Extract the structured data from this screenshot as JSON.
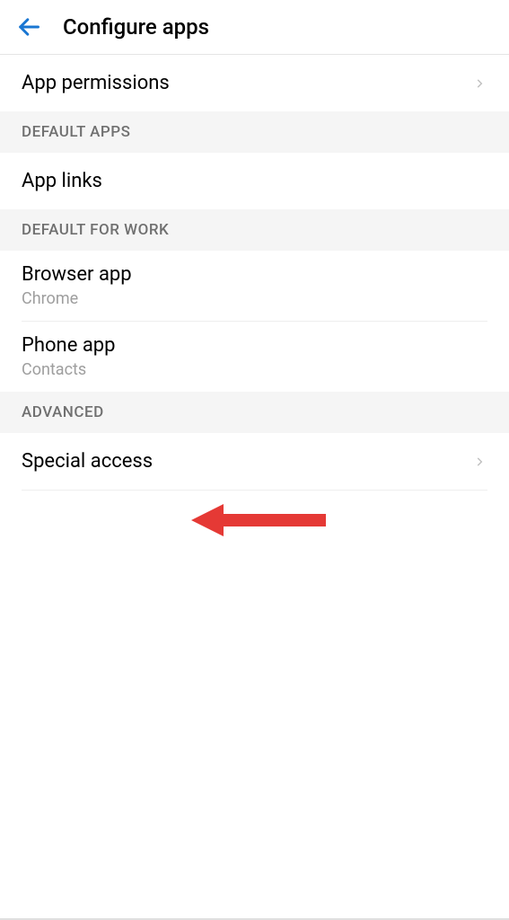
{
  "header": {
    "title": "Configure apps"
  },
  "sections": {
    "app_permissions": {
      "title": "App permissions"
    },
    "default_apps_header": "DEFAULT APPS",
    "app_links": {
      "title": "App links"
    },
    "default_for_work_header": "DEFAULT FOR WORK",
    "browser_app": {
      "title": "Browser app",
      "subtitle": "Chrome"
    },
    "phone_app": {
      "title": "Phone app",
      "subtitle": "Contacts"
    },
    "advanced_header": "ADVANCED",
    "special_access": {
      "title": "Special access"
    }
  }
}
